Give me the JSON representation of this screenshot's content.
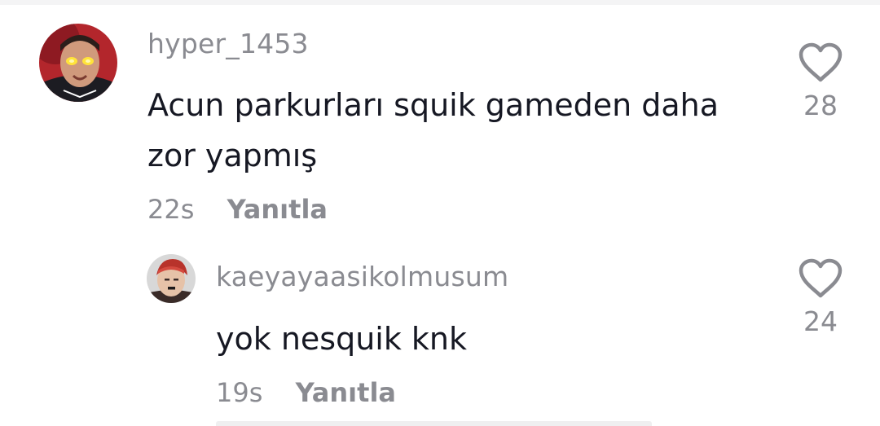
{
  "comments": [
    {
      "username": "hyper_1453",
      "text": "Acun parkurları squik gameden daha zor yapmış",
      "time": "22s",
      "reply_label": "Yanıtla",
      "likes": "28",
      "avatar_icon": "profile-avatar"
    },
    {
      "username": "kaeyayaasikolmusum",
      "text": "yok nesquik knk",
      "time": "19s",
      "reply_label": "Yanıtla",
      "likes": "24",
      "avatar_icon": "profile-avatar"
    }
  ],
  "colors": {
    "text": "#161823",
    "muted": "#8a8b91",
    "background": "#ffffff"
  }
}
